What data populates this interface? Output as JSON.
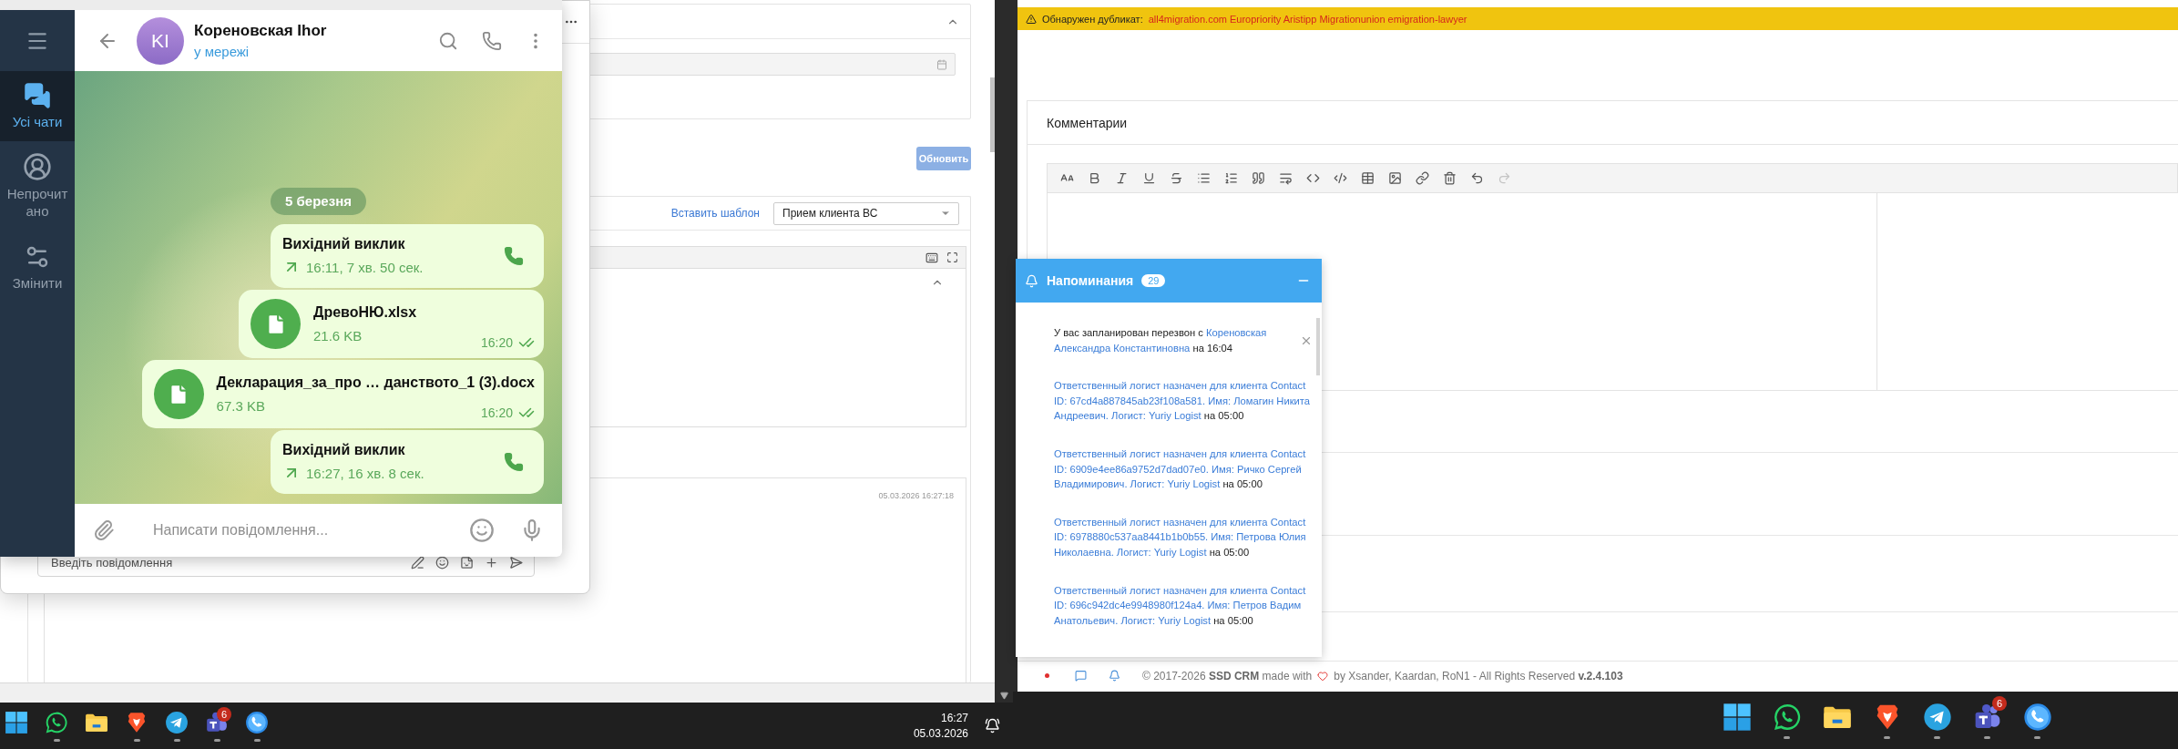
{
  "left_screen": {
    "crm_form": {
      "update_button": "Обновить",
      "template_link": "Вставить шаблон",
      "template_select": {
        "value": "Прием клиента ВС"
      },
      "comment_timestamp": "05.03.2026 16:27:18"
    },
    "back_window": {
      "input": {
        "placeholder": "Введіть повідомлення"
      }
    },
    "telegram": {
      "sidebar": [
        {
          "label": "Усі чати",
          "kind": "chats",
          "selected": true
        },
        {
          "label": "Непрочитано",
          "kind": "unread",
          "selected": false
        },
        {
          "label": "Змінити",
          "kind": "edit",
          "selected": false
        }
      ],
      "chat": {
        "initials": "KI",
        "name": "Кореновская Ihor",
        "status": "у мережі"
      },
      "date_divider": "5 березня",
      "messages": [
        {
          "kind": "call",
          "title": "Вихідний виклик",
          "detail": "16:11, 7 хв. 50 сек."
        },
        {
          "kind": "file",
          "name": "ДревоНЮ.xlsx",
          "size": "21.6 KB",
          "time": "16:20",
          "read": true
        },
        {
          "kind": "file",
          "name": "Декларация_за_про … данството_1 (3).docx",
          "size": "67.3 KB",
          "time": "16:20",
          "read": true
        },
        {
          "kind": "call",
          "title": "Вихідний виклик",
          "detail": "16:27, 16 хв. 8 сек."
        }
      ],
      "composer": {
        "placeholder": "Написати повідомлення..."
      }
    },
    "taskbar": {
      "apps": [
        {
          "kind": "start",
          "running": false
        },
        {
          "kind": "chat",
          "running": true
        },
        {
          "kind": "folder",
          "running": false
        },
        {
          "kind": "lion",
          "running": true
        },
        {
          "kind": "plane",
          "running": true
        },
        {
          "kind": "team",
          "running": true,
          "badge": "6"
        },
        {
          "kind": "phone",
          "running": true
        }
      ],
      "time": "16:27",
      "date": "05.03.2026"
    }
  },
  "right_screen": {
    "duplicate_banner": {
      "label": "Обнаружен дубликат:",
      "matches": "all4migration.com Europriority Aristipp Migrationunion emigration-lawyer"
    },
    "comments": {
      "title": "Комментарии",
      "toolbar": {
        "redo_disabled": true
      }
    },
    "reminders": {
      "title": "Напоминания",
      "count": "29",
      "items": [
        {
          "text": "У вас запланирован перезвон с",
          "link": "Кореновская Александра Константиновна",
          "suffix": "на 16:04",
          "dismissible": true
        },
        {
          "link": "Ответственный логист назначен для клиента Contact ID: 67cd4a887845ab23f108a581. Имя: Ломагин Никита Андреевич. Логист: Yuriy Logist",
          "suffix": "на 05:00",
          "dismissible": false
        },
        {
          "link": "Ответственный логист назначен для клиента Contact ID: 6909e4ee86a9752d7dad07e0. Имя: Ричко Сергей Владимирович. Логист: Yuriy Logist",
          "suffix": "на 05:00",
          "dismissible": false
        },
        {
          "link": "Ответственный логист назначен для клиента Contact ID: 6978880c537aa8441b1b0b55. Имя: Петрова Юлия Николаевна. Логист: Yuriy Logist",
          "suffix": "на 05:00",
          "dismissible": false
        },
        {
          "link": "Ответственный логист назначен для клиента Contact ID: 696c942dc4e9948980f124a4. Имя: Петров Вадим Анатольевич. Логист: Yuriy Logist",
          "suffix": "на 05:00",
          "dismissible": false
        }
      ]
    },
    "footer": {
      "copyright": "© 2017-2026 **SSD CRM** made with",
      "credits": "by Xsander, Kaardan, RoN1 - All Rights Reserved **v.2.4.103**"
    },
    "taskbar": {
      "apps": [
        {
          "kind": "start",
          "running": false
        },
        {
          "kind": "chat",
          "running": true
        },
        {
          "kind": "folder",
          "running": false
        },
        {
          "kind": "lion",
          "running": true
        },
        {
          "kind": "plane",
          "running": true
        },
        {
          "kind": "team",
          "running": true,
          "badge": "6"
        },
        {
          "kind": "phone",
          "running": true
        }
      ]
    }
  }
}
